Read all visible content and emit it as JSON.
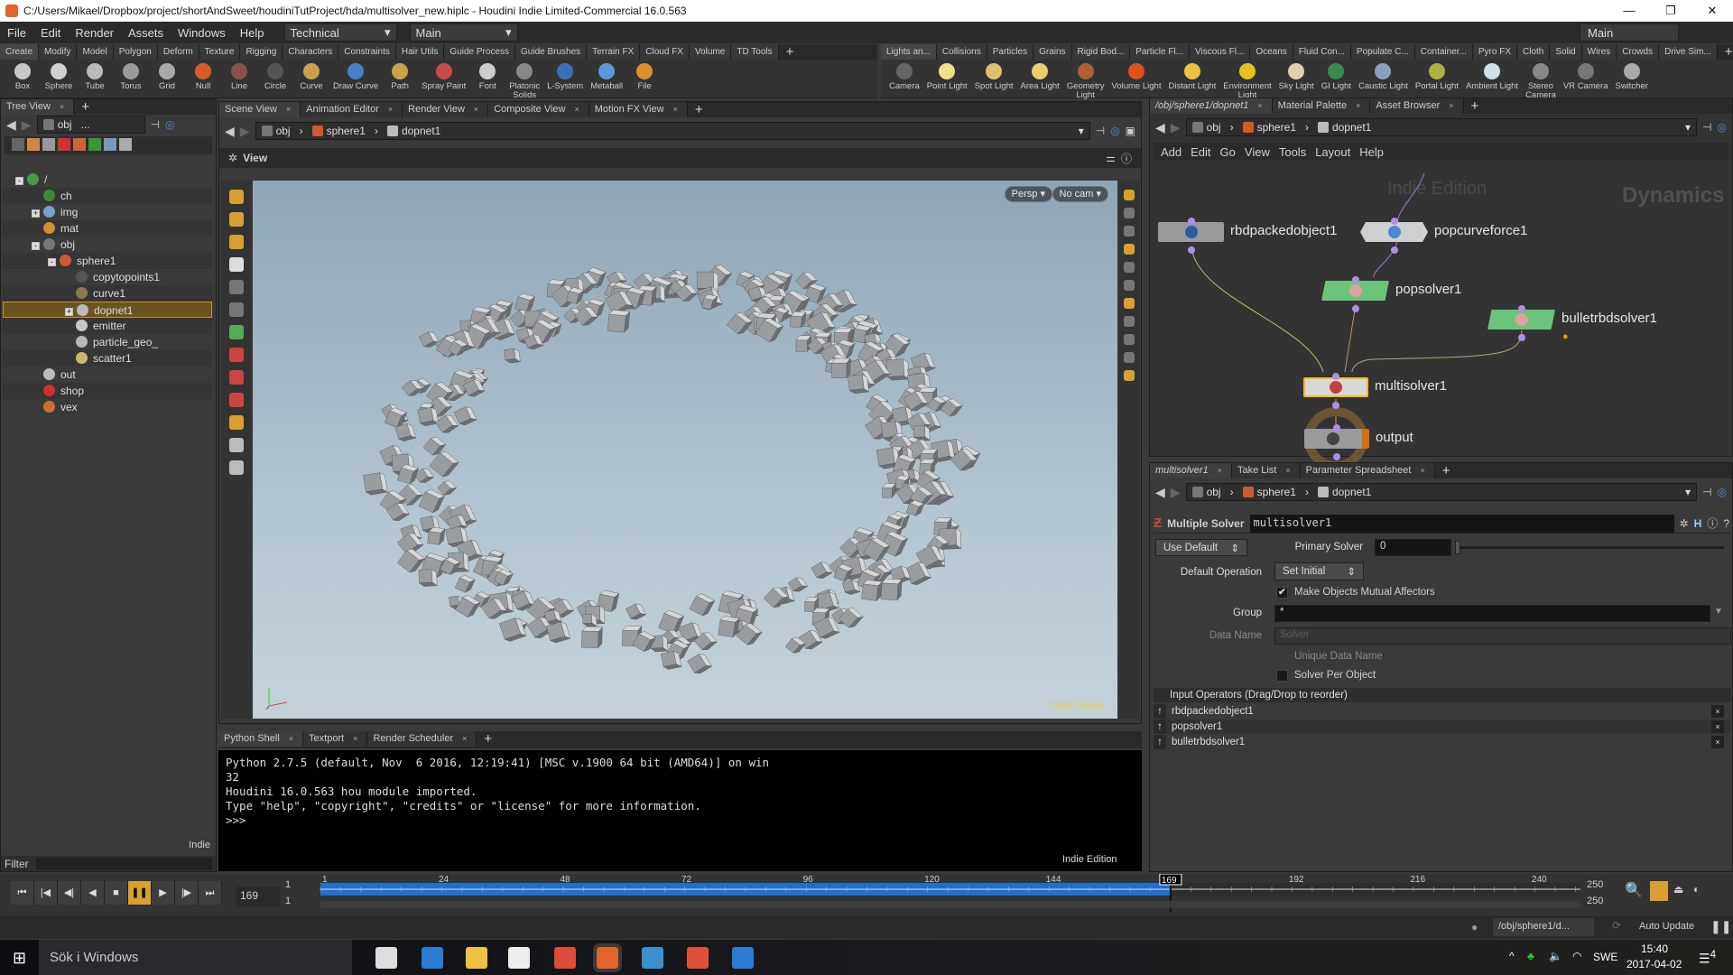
{
  "title_bar": {
    "text": "C:/Users/Mikael/Dropbox/project/shortAndSweet/houdiniTutProject/hda/multisolver_new.hiplc - Houdini Indie Limited-Commercial 16.0.563",
    "buttons": [
      "—",
      "❐",
      "✕"
    ]
  },
  "menu": {
    "items": [
      "File",
      "Edit",
      "Render",
      "Assets",
      "Windows",
      "Help"
    ],
    "desktop": "Technical",
    "context": "Main",
    "desktop_right": "Main"
  },
  "shelf_left": {
    "tabs": [
      "Create",
      "Modify",
      "Model",
      "Polygon",
      "Deform",
      "Texture",
      "Rigging",
      "Characters",
      "Constraints",
      "Hair Utils",
      "Guide Process",
      "Guide Brushes",
      "Terrain FX",
      "Cloud FX",
      "Volume",
      "TD Tools"
    ],
    "tools": [
      {
        "label": "Box",
        "icon": "box-icon",
        "color": "#c8c8c8"
      },
      {
        "label": "Sphere",
        "icon": "sphere-icon",
        "color": "#d0d0d0"
      },
      {
        "label": "Tube",
        "icon": "tube-icon",
        "color": "#bbbbbb"
      },
      {
        "label": "Torus",
        "icon": "torus-icon",
        "color": "#9a9a9a"
      },
      {
        "label": "Grid",
        "icon": "grid-icon",
        "color": "#aaaaaa"
      },
      {
        "label": "Null",
        "icon": "null-icon",
        "color": "#d65d2a"
      },
      {
        "label": "Line",
        "icon": "line-icon",
        "color": "#8a5050"
      },
      {
        "label": "Circle",
        "icon": "circle-icon",
        "color": "#555555"
      },
      {
        "label": "Curve",
        "icon": "curve-icon",
        "color": "#c9a24a"
      },
      {
        "label": "Draw Curve",
        "icon": "draw-curve-icon",
        "color": "#4a7fc9"
      },
      {
        "label": "Path",
        "icon": "path-icon",
        "color": "#c9a24a"
      },
      {
        "label": "Spray Paint",
        "icon": "spray-paint-icon",
        "color": "#c94a4a"
      },
      {
        "label": "Font",
        "icon": "font-icon",
        "color": "#cccccc"
      },
      {
        "label": "Platonic\nSolids",
        "icon": "platonic-solids-icon",
        "color": "#888888"
      },
      {
        "label": "L-System",
        "icon": "l-system-icon",
        "color": "#3d6fb8"
      },
      {
        "label": "Metaball",
        "icon": "metaball-icon",
        "color": "#5a9ad8"
      },
      {
        "label": "File",
        "icon": "file-icon",
        "color": "#e0902a"
      }
    ]
  },
  "shelf_right": {
    "tabs": [
      "Lights an...",
      "Collisions",
      "Particles",
      "Grains",
      "Rigid Bod...",
      "Particle Fl...",
      "Viscous Fl...",
      "Oceans",
      "Fluid Con...",
      "Populate C...",
      "Container...",
      "Pyro FX",
      "Cloth",
      "Solid",
      "Wires",
      "Crowds",
      "Drive Sim..."
    ],
    "tools": [
      {
        "label": "Camera",
        "icon": "camera-icon",
        "color": "#666666"
      },
      {
        "label": "Point Light",
        "icon": "point-light-icon",
        "color": "#f0e08a"
      },
      {
        "label": "Spot Light",
        "icon": "spot-light-icon",
        "color": "#e0c070"
      },
      {
        "label": "Area Light",
        "icon": "area-light-icon",
        "color": "#e8d070"
      },
      {
        "label": "Geometry\nLight",
        "icon": "geometry-light-icon",
        "color": "#b06030"
      },
      {
        "label": "Volume Light",
        "icon": "volume-light-icon",
        "color": "#e05020"
      },
      {
        "label": "Distant Light",
        "icon": "distant-light-icon",
        "color": "#f0c040"
      },
      {
        "label": "Environment\nLight",
        "icon": "environment-light-icon",
        "color": "#e8c020"
      },
      {
        "label": "Sky Light",
        "icon": "sky-light-icon",
        "color": "#e0d0b0"
      },
      {
        "label": "GI Light",
        "icon": "gi-light-icon",
        "color": "#3a8a50"
      },
      {
        "label": "Caustic Light",
        "icon": "caustic-light-icon",
        "color": "#8aa0c0"
      },
      {
        "label": "Portal Light",
        "icon": "portal-light-icon",
        "color": "#b0b040"
      },
      {
        "label": "Ambient Light",
        "icon": "ambient-light-icon",
        "color": "#d0e0e8"
      },
      {
        "label": "Stereo\nCamera",
        "icon": "stereo-camera-icon",
        "color": "#888888"
      },
      {
        "label": "VR Camera",
        "icon": "vr-camera-icon",
        "color": "#777777"
      },
      {
        "label": "Switcher",
        "icon": "switcher-icon",
        "color": "#aaaaaa"
      }
    ]
  },
  "tree_view": {
    "tab": "Tree View",
    "path": [
      "obj",
      "..."
    ],
    "filter_label": "Filter",
    "watermark": "Indie",
    "items": [
      {
        "label": "/",
        "level": 0,
        "toggle": "-",
        "icon": "globe-icon",
        "color": "#4a9a4a"
      },
      {
        "label": "ch",
        "level": 1,
        "icon": "channel-icon",
        "color": "#3a8a3a"
      },
      {
        "label": "img",
        "level": 1,
        "toggle": "+",
        "icon": "image-network-icon",
        "color": "#7aa0c8"
      },
      {
        "label": "mat",
        "level": 1,
        "icon": "material-icon",
        "color": "#d0902a"
      },
      {
        "label": "obj",
        "level": 1,
        "toggle": "-",
        "icon": "object-network-icon",
        "color": "#777777"
      },
      {
        "label": "sphere1",
        "level": 2,
        "toggle": "-",
        "icon": "geometry-icon",
        "color": "#d05a30"
      },
      {
        "label": "copytopoints1",
        "level": 3,
        "icon": "copy-to-points-icon",
        "color": "#555555"
      },
      {
        "label": "curve1",
        "level": 3,
        "icon": "curve-icon",
        "color": "#8a7a50"
      },
      {
        "label": "dopnet1",
        "level": 3,
        "toggle": "+",
        "icon": "dopnet-icon",
        "color": "#bbbbbb",
        "selected": true
      },
      {
        "label": "emitter",
        "level": 3,
        "icon": "sphere-icon",
        "color": "#c8c8c8"
      },
      {
        "label": "particle_geo_",
        "level": 3,
        "icon": "box-icon",
        "color": "#b8b8b8"
      },
      {
        "label": "scatter1",
        "level": 3,
        "icon": "scatter-icon",
        "color": "#c8b870"
      },
      {
        "label": "out",
        "level": 1,
        "icon": "output-network-icon",
        "color": "#bbbbbb"
      },
      {
        "label": "shop",
        "level": 1,
        "icon": "shop-icon",
        "color": "#d03030"
      },
      {
        "label": "vex",
        "level": 1,
        "icon": "vex-icon",
        "color": "#d07030"
      }
    ]
  },
  "scene_view": {
    "tabs": [
      "Scene View",
      "Animation Editor",
      "Render View",
      "Composite View",
      "Motion FX View"
    ],
    "path": [
      "obj",
      "sphere1",
      "dopnet1"
    ],
    "view_label": "View",
    "persp": "Persp ▾",
    "cam": "No cam ▾",
    "watermark": "Indie Edition"
  },
  "python_shell": {
    "tabs": [
      "Python Shell",
      "Textport",
      "Render Scheduler"
    ],
    "lines": [
      "Python 2.7.5 (default, Nov  6 2016, 12:19:41) [MSC v.1900 64 bit (AMD64)] on win",
      "32",
      "Houdini 16.0.563 hou module imported.",
      "Type \"help\", \"copyright\", \"credits\" or \"license\" for more information.",
      ">>> "
    ],
    "watermark": "Indie Edition"
  },
  "network": {
    "tabs": [
      "/obj/sphere1/dopnet1",
      "Material Palette",
      "Asset Browser"
    ],
    "path": [
      "obj",
      "sphere1",
      "dopnet1"
    ],
    "menu": [
      "Add",
      "Edit",
      "Go",
      "View",
      "Tools",
      "Layout",
      "Help"
    ],
    "watermark": "Indie Edition",
    "context_label": "Dynamics",
    "nodes": [
      {
        "name": "rbdpackedobject1",
        "color": "#9a9a9a"
      },
      {
        "name": "popcurveforce1",
        "color": "#cfcfcf"
      },
      {
        "name": "popsolver1",
        "color": "#6cc47a"
      },
      {
        "name": "bulletrbdsolver1",
        "color": "#6cc47a",
        "warning": true
      },
      {
        "name": "multisolver1",
        "color": "#d8d8d8",
        "selected": true
      },
      {
        "name": "output",
        "color": "#9a9a9a",
        "display": true
      }
    ]
  },
  "parameters": {
    "tabs": [
      "multisolver1",
      "Take List",
      "Parameter Spreadsheet"
    ],
    "path": [
      "obj",
      "sphere1",
      "dopnet1"
    ],
    "node_type": "Multiple Solver",
    "node_name": "multisolver1",
    "use_default": "Use Default",
    "primary_solver_label": "Primary Solver",
    "primary_solver": "0",
    "primary_solver_fraction": 0,
    "default_operation_label": "Default Operation",
    "default_operation": "Set Initial",
    "mutual_affectors_label": "Make Objects Mutual Affectors",
    "mutual_affectors": true,
    "group_label": "Group",
    "group": "*",
    "data_name_label": "Data Name",
    "data_name_placeholder": "Solver",
    "unique_data_name_label": "Unique Data Name",
    "unique_data_name": false,
    "solver_per_object_label": "Solver Per Object",
    "solver_per_object": false,
    "input_operators_header": "Input Operators (Drag/Drop to reorder)",
    "input_operators": [
      "rbdpackedobject1",
      "popsolver1",
      "bulletrbdsolver1"
    ]
  },
  "timeline": {
    "current_frame": "169",
    "start": "1",
    "end": "1",
    "range_end": "250",
    "range_end2": "250",
    "ticks": [
      "1",
      "24",
      "48",
      "72",
      "96",
      "120",
      "144",
      "192",
      "216",
      "240"
    ],
    "first": 1,
    "last": 250,
    "frame": 169,
    "playing": true
  },
  "status": {
    "path": "/obj/sphere1/d...",
    "update": "Auto Update"
  },
  "taskbar": {
    "search": "Sök i Windows",
    "time": "15:40",
    "date": "2017-04-02",
    "lang": "SWE",
    "notifications": "4",
    "apps": [
      {
        "icon": "task-view-icon",
        "color": "#dddddd"
      },
      {
        "icon": "edge-icon",
        "color": "#2b7cd3"
      },
      {
        "icon": "file-explorer-icon",
        "color": "#f0c040"
      },
      {
        "icon": "store-icon",
        "color": "#eeeeee"
      },
      {
        "icon": "chrome-icon",
        "color": "#dd4b39"
      },
      {
        "icon": "houdini-icon",
        "color": "#e2632b"
      },
      {
        "icon": "remote-desktop-icon",
        "color": "#3a90d0"
      },
      {
        "icon": "sublime-icon",
        "color": "#e0503a"
      },
      {
        "icon": "clock-app-icon",
        "color": "#2b7cd3"
      }
    ]
  }
}
